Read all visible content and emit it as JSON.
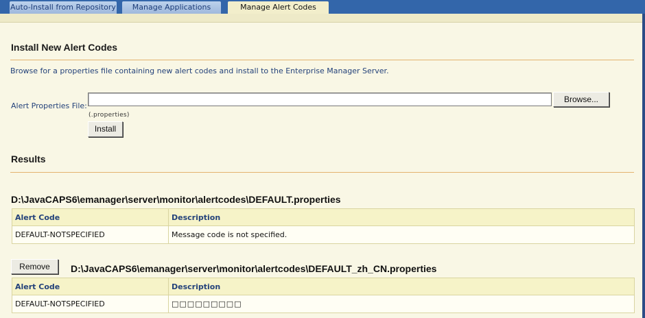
{
  "tabs": [
    {
      "label": "Auto-Install from Repository",
      "active": false
    },
    {
      "label": "Manage Applications",
      "active": false
    },
    {
      "label": "Manage Alert Codes",
      "active": true
    }
  ],
  "install": {
    "heading": "Install New Alert Codes",
    "description": "Browse for a properties file containing new alert codes and install to the Enterprise Manager Server.",
    "field_label": "Alert Properties File:",
    "field_value": "",
    "browse_label": "Browse...",
    "extension_hint": "(.properties)",
    "install_label": "Install"
  },
  "results": {
    "heading": "Results",
    "files": [
      {
        "path": "D:\\JavaCAPS6\\emanager\\server\\monitor\\alertcodes\\DEFAULT.properties",
        "removable": false,
        "columns": [
          "Alert Code",
          "Description"
        ],
        "rows": [
          [
            "DEFAULT-NOTSPECIFIED",
            "Message code is not specified."
          ]
        ]
      },
      {
        "path": "D:\\JavaCAPS6\\emanager\\server\\monitor\\alertcodes\\DEFAULT_zh_CN.properties",
        "removable": true,
        "remove_label": "Remove",
        "columns": [
          "Alert Code",
          "Description"
        ],
        "rows": [
          [
            "DEFAULT-NOTSPECIFIED",
            "□□□□□□□□□"
          ]
        ]
      }
    ]
  },
  "colors": {
    "tab_bar": "#3366aa",
    "page_bg": "#f9f7e5",
    "accent_rule": "#e3b26e",
    "label_text": "#24427a"
  }
}
